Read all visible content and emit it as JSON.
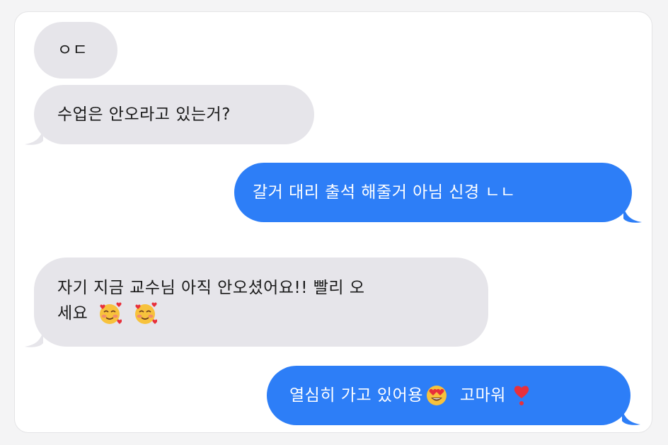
{
  "conversation": {
    "messages": [
      {
        "direction": "received",
        "text": "ㅇㄷ"
      },
      {
        "direction": "received",
        "text": "수업은 안오라고 있는거?"
      },
      {
        "direction": "sent",
        "text": "갈거 대리 출석 해줄거 아님 신경 ㄴㄴ"
      },
      {
        "direction": "received",
        "line1": "자기 지금 교수님 아직 안오셨어요!! 빨리 오",
        "line2": "세요"
      },
      {
        "direction": "sent",
        "text_part1": "열심히 가고 있어용",
        "text_part2": "고마워"
      }
    ]
  },
  "icons": {
    "smiling_face_with_hearts": "smiling-face-with-hearts-icon",
    "heart_eyes": "heart-eyes-icon",
    "heart_exclamation": "heart-exclamation-icon"
  },
  "colors": {
    "sent_bubble": "#2d7ef7",
    "received_bubble": "#e6e5ea",
    "received_text": "#1a1a1a",
    "sent_text": "#ffffff"
  }
}
